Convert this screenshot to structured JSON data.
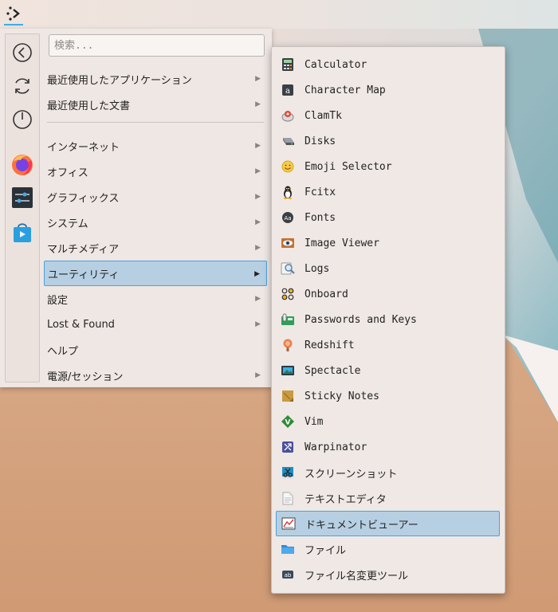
{
  "colors": {
    "accent": "#3daee9",
    "selection_bg": "#b7cfe2",
    "menu_bg": "#efe7e3"
  },
  "panel": {
    "launcher_icon": "kde-launcher-icon"
  },
  "favorites": [
    {
      "name": "back-icon"
    },
    {
      "name": "refresh-icon"
    },
    {
      "name": "power-icon"
    },
    {
      "name": "firefox-icon"
    },
    {
      "name": "settings-sliders-icon"
    },
    {
      "name": "discover-store-icon"
    }
  ],
  "search": {
    "placeholder": "検索..."
  },
  "categories": {
    "recent_apps": "最近使用したアプリケーション",
    "recent_docs": "最近使用した文書",
    "internet": "インターネット",
    "office": "オフィス",
    "graphics": "グラフィックス",
    "system": "システム",
    "multimedia": "マルチメディア",
    "utilities": "ユーティリティ",
    "settings": "設定",
    "lost_found": "Lost & Found",
    "help": "ヘルプ",
    "power_session": "電源/セッション"
  },
  "apps": [
    {
      "label": "Calculator",
      "icon": "calculator-icon"
    },
    {
      "label": "Character Map",
      "icon": "character-map-icon"
    },
    {
      "label": "ClamTk",
      "icon": "clamtk-icon"
    },
    {
      "label": "Disks",
      "icon": "disks-icon"
    },
    {
      "label": "Emoji Selector",
      "icon": "emoji-icon"
    },
    {
      "label": "Fcitx",
      "icon": "penguin-icon"
    },
    {
      "label": "Fonts",
      "icon": "fonts-icon"
    },
    {
      "label": "Image Viewer",
      "icon": "image-viewer-icon"
    },
    {
      "label": "Logs",
      "icon": "logs-icon"
    },
    {
      "label": "Onboard",
      "icon": "onboard-icon"
    },
    {
      "label": "Passwords and Keys",
      "icon": "passwords-icon"
    },
    {
      "label": "Redshift",
      "icon": "redshift-icon"
    },
    {
      "label": "Spectacle",
      "icon": "spectacle-icon"
    },
    {
      "label": "Sticky Notes",
      "icon": "sticky-notes-icon"
    },
    {
      "label": "Vim",
      "icon": "vim-icon"
    },
    {
      "label": "Warpinator",
      "icon": "warpinator-icon"
    },
    {
      "label": "スクリーンショット",
      "icon": "screenshot-icon"
    },
    {
      "label": "テキストエディタ",
      "icon": "text-editor-icon"
    },
    {
      "label": "ドキュメントビューアー",
      "icon": "document-viewer-icon"
    },
    {
      "label": "ファイル",
      "icon": "folder-icon"
    },
    {
      "label": "ファイル名変更ツール",
      "icon": "rename-tool-icon"
    }
  ]
}
